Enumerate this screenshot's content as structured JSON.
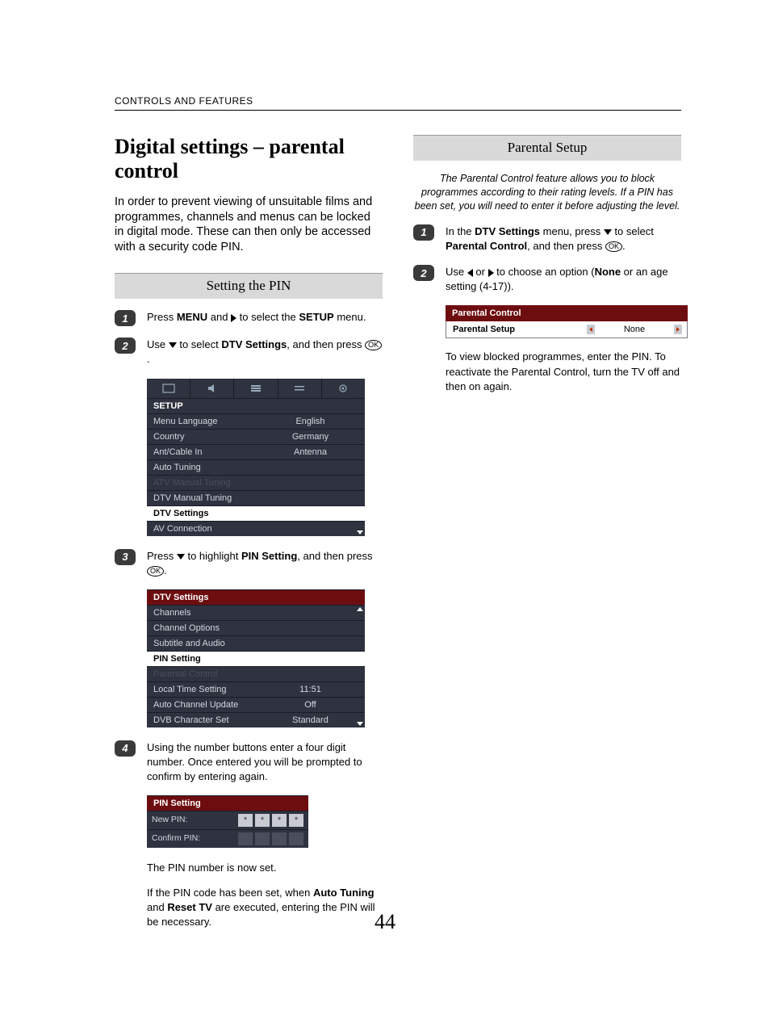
{
  "header": "CONTROLS AND FEATURES",
  "page_number": "44",
  "left": {
    "title": "Digital settings – parental control",
    "intro": "In order to prevent viewing of unsuitable films and programmes, channels and menus can be locked in digital mode. These can then only be accessed with a security code PIN.",
    "section1_title": "Setting the PIN",
    "step1": {
      "num": "1",
      "pre": "Press ",
      "b1": "MENU",
      "mid": " and ",
      "post": " to select the ",
      "b2": "SETUP",
      "end": " menu."
    },
    "step2": {
      "num": "2",
      "pre": "Use ",
      "mid": " to select ",
      "b1": "DTV Settings",
      "post": ", and then press ",
      "ok": "OK",
      "end": "."
    },
    "setup_menu": {
      "title": "SETUP",
      "rows": [
        {
          "l": "Menu Language",
          "r": "English"
        },
        {
          "l": "Country",
          "r": "Germany"
        },
        {
          "l": "Ant/Cable In",
          "r": "Antenna"
        },
        {
          "l": "Auto Tuning",
          "r": ""
        },
        {
          "l": "ATV Manual Tuning",
          "r": "",
          "dim": true
        },
        {
          "l": "DTV Manual Tuning",
          "r": ""
        },
        {
          "l": "DTV Settings",
          "r": "",
          "sel": true
        },
        {
          "l": "AV Connection",
          "r": "",
          "last": true
        }
      ]
    },
    "step3": {
      "num": "3",
      "pre": "Press ",
      "mid": " to highlight ",
      "b1": "PIN Setting",
      "post": ", and then press ",
      "ok": "OK",
      "end": "."
    },
    "dtv_menu": {
      "title": "DTV Settings",
      "rows": [
        {
          "l": "Channels",
          "r": "",
          "first": true
        },
        {
          "l": "Channel Options",
          "r": ""
        },
        {
          "l": "Subtitle and Audio",
          "r": ""
        },
        {
          "l": "PIN Setting",
          "r": "",
          "sel": true
        },
        {
          "l": "Parental Control",
          "r": "",
          "dim": true
        },
        {
          "l": "Local Time Setting",
          "r": "11:51"
        },
        {
          "l": "Auto Channel Update",
          "r": "Off"
        },
        {
          "l": "DVB Character Set",
          "r": "Standard",
          "last": true
        }
      ]
    },
    "step4": {
      "num": "4",
      "text": "Using the number buttons enter a four digit number. Once entered you will be prompted to confirm by entering again."
    },
    "pin_menu": {
      "title": "PIN Setting",
      "new_label": "New PIN:",
      "confirm_label": "Confirm PIN:",
      "star": "*"
    },
    "after1": "The PIN number is now set.",
    "after2_pre": "If the PIN code has been set, when ",
    "after2_b1": "Auto Tuning",
    "after2_mid": " and ",
    "after2_b2": "Reset TV",
    "after2_post": " are executed, entering the PIN will be necessary."
  },
  "right": {
    "section_title": "Parental Setup",
    "blurb": "The Parental Control feature allows you to block programmes according to their rating levels. If a PIN has been set, you will need to enter it before adjusting the level.",
    "step1": {
      "num": "1",
      "pre": "In the ",
      "b1": "DTV Settings",
      "mid": " menu, press ",
      "post": " to select ",
      "b2": "Parental Control",
      "end2": ", and then press ",
      "ok": "OK",
      "end": "."
    },
    "step2": {
      "num": "2",
      "pre": "Use ",
      "mid": " or ",
      "post": " to choose an option (",
      "b1": "None",
      "end": " or an age setting (4-17))."
    },
    "pc_menu": {
      "head": "Parental Control",
      "row_label": "Parental Setup",
      "row_value": "None"
    },
    "after": "To view blocked programmes, enter the PIN. To reactivate the Parental Control, turn the TV off and then on again."
  }
}
